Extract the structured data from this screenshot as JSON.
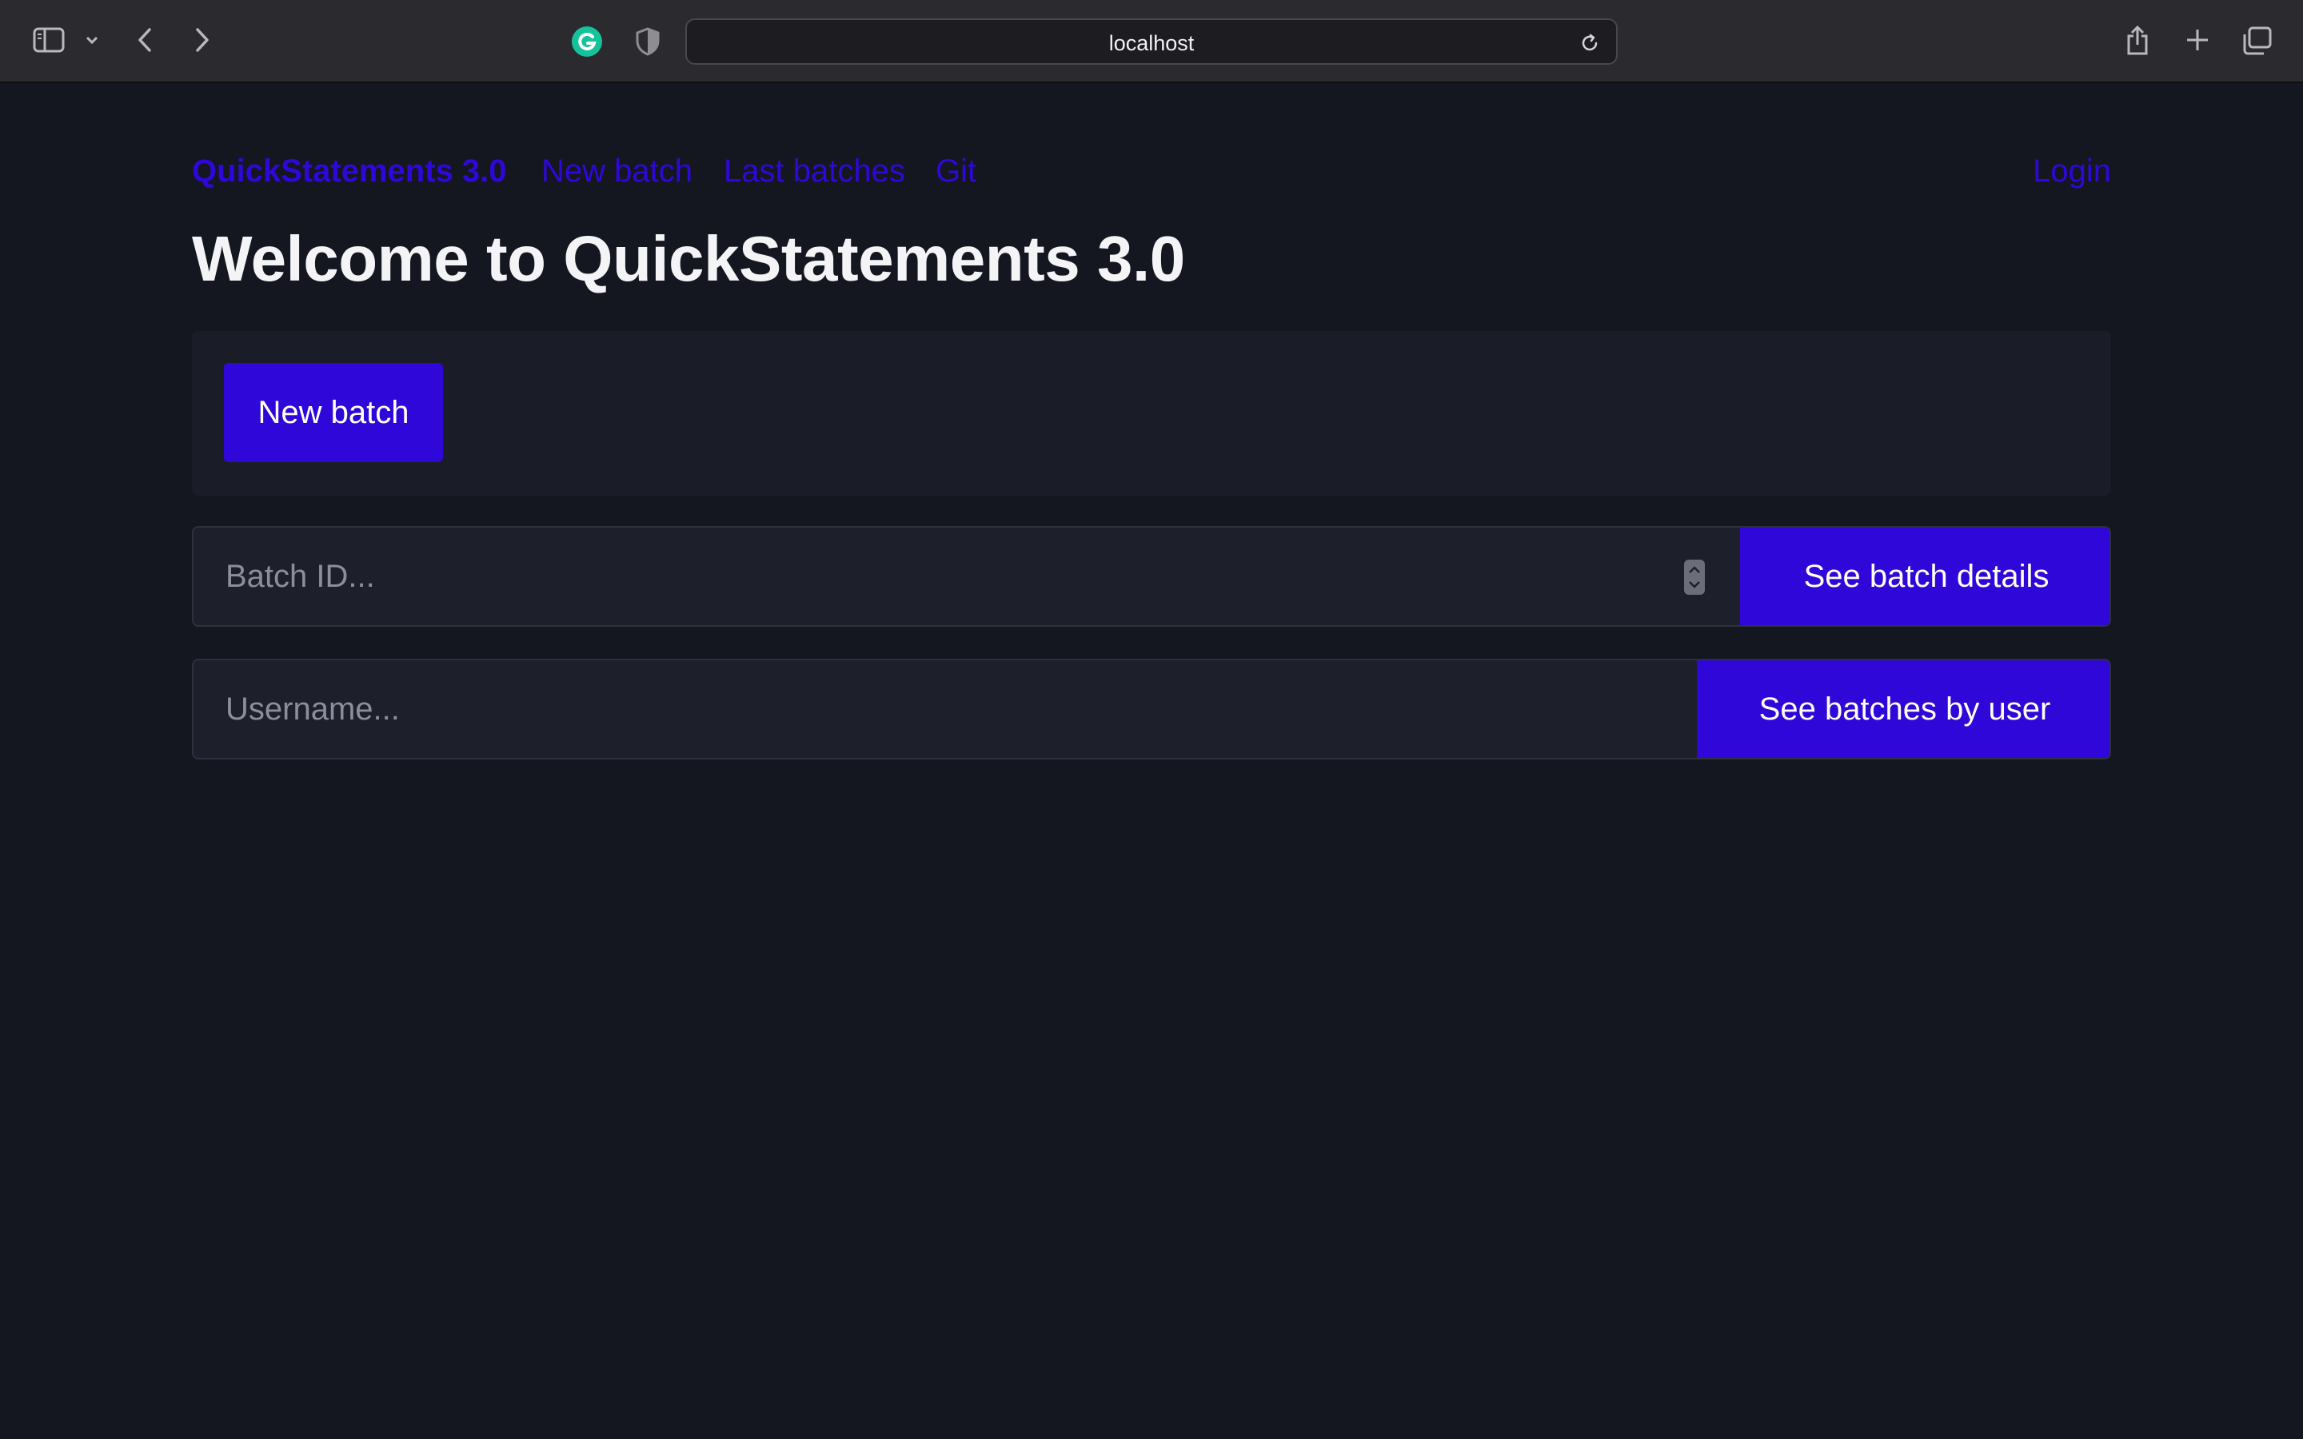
{
  "browser": {
    "url": "localhost"
  },
  "nav": {
    "brand": "QuickStatements 3.0",
    "links": [
      "New batch",
      "Last batches",
      "Git"
    ],
    "login": "Login"
  },
  "main": {
    "title": "Welcome to QuickStatements 3.0",
    "new_batch_button": "New batch",
    "batch_search": {
      "placeholder": "Batch ID...",
      "button": "See batch details"
    },
    "user_search": {
      "placeholder": "Username...",
      "button": "See batches by user"
    }
  },
  "colors": {
    "accent": "#2f07d8",
    "background": "#141720",
    "card": "#1a1d27",
    "input": "#1d202b"
  }
}
